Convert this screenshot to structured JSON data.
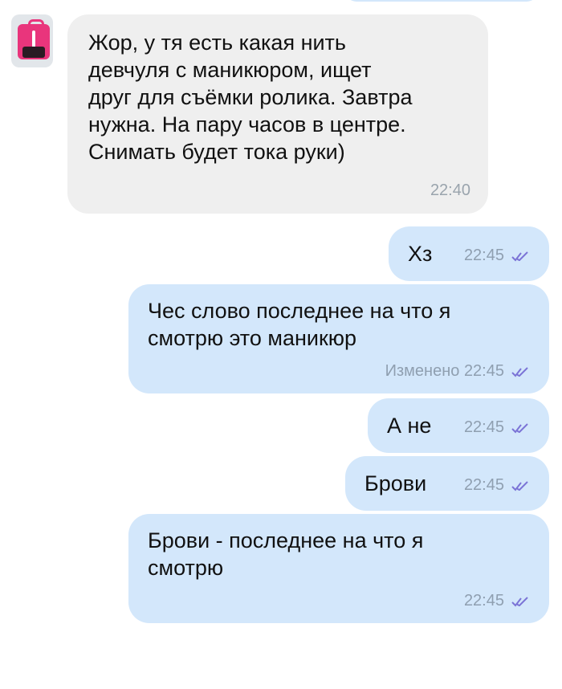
{
  "contact": {
    "avatar_icon": "pink-bag-avatar-icon"
  },
  "colors": {
    "incoming_bubble": "#efefef",
    "outgoing_bubble": "#d3e7fb",
    "read_ticks": "#7b74d6",
    "meta_text": "#9aa4ad"
  },
  "messages": [
    {
      "direction": "in",
      "text": "Жор, у тя есть какая нить\nдевчуля с маникюром, ищет\nдруг для съёмки ролика. Завтра\nнужна. На пару часов в центре.\nСнимать будет тока руки)",
      "time": "22:40"
    },
    {
      "direction": "out",
      "text": "Хз",
      "time": "22:45",
      "status_icon": "double-check-icon"
    },
    {
      "direction": "out",
      "text": "Чес слово последнее на что я\nсмотрю это маникюр",
      "edited_label": "Изменено",
      "time": "22:45",
      "status_icon": "double-check-icon"
    },
    {
      "direction": "out",
      "text": "А не",
      "time": "22:45",
      "status_icon": "double-check-icon"
    },
    {
      "direction": "out",
      "text": "Брови",
      "time": "22:45",
      "status_icon": "double-check-icon"
    },
    {
      "direction": "out",
      "text": "Брови - последнее на что я\nсмотрю",
      "time": "22:45",
      "status_icon": "double-check-icon"
    }
  ]
}
